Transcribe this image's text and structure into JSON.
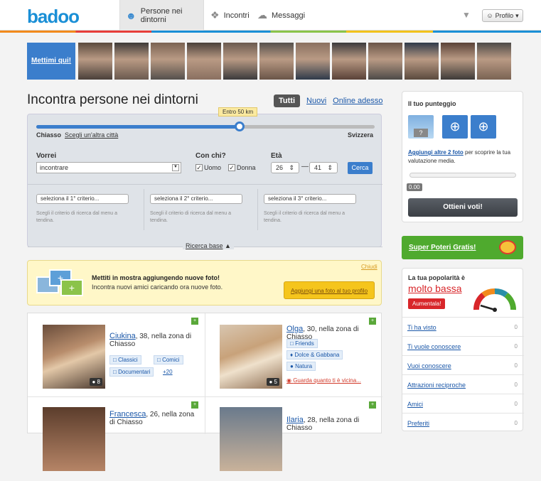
{
  "header": {
    "logo": "badoo",
    "nav": [
      {
        "label": "Persone nei dintorni",
        "icon": "people-icon"
      },
      {
        "label": "Incontri",
        "icon": "puzzle-icon"
      },
      {
        "label": "Messaggi",
        "icon": "chat-icon"
      }
    ],
    "profile_label": "Profilo"
  },
  "strip": {
    "cta": "Mettimi qui!"
  },
  "main": {
    "title": "Incontra persone nei dintorni",
    "tabs": [
      "Tutti",
      "Nuovi",
      "Online adesso"
    ]
  },
  "search": {
    "distance_tooltip": "Entro 50 km",
    "distance_fraction": 0.6,
    "left_label": "Chiasso",
    "city_link": "Scegli un'altra città",
    "right_label": "Svizzera",
    "vorrei_label": "Vorrei",
    "vorrei_value": "incontrare",
    "conchi_label": "Con chi?",
    "uomo": "Uomo",
    "donna": "Donna",
    "eta_label": "Età",
    "age_min": "26",
    "age_max": "41",
    "cerca": "Cerca",
    "criteria": [
      "seleziona il 1° criterio...",
      "seleziona il 2° criterio...",
      "seleziona il 3° criterio..."
    ],
    "criteria_hint": "Scegli il criterio di ricerca dal menu a tendina.",
    "basic_search": "Ricerca base"
  },
  "promo": {
    "title": "Mettiti in mostra aggiungendo nuove foto!",
    "subtitle": "Incontra nuovi amici caricando ora nuove foto.",
    "close": "Chiudi",
    "button": "Aggiungi una foto al tuo profilo"
  },
  "results": [
    {
      "name": "Ciukina",
      "info": ", 38, nella zona di Chiasso",
      "photos": "8",
      "tags": [
        "Classici",
        "Comici",
        "Documentari"
      ],
      "more": "+20"
    },
    {
      "name": "Olga",
      "info": ", 30, nella zona di Chiasso",
      "photos": "5",
      "tags": [
        "Friends",
        "Dolce & Gabbana",
        "Natura"
      ],
      "link": "Guarda quanto ti è vicina..."
    },
    {
      "name": "Francesca",
      "info": ", 26, nella zona di Chiasso"
    },
    {
      "name": "Ilaria",
      "info": ", 28, nella zona di Chiasso"
    }
  ],
  "sidebar": {
    "score_title": "Il tuo punteggio",
    "score_link": "Aggiungi altre 2 foto",
    "score_text": " per scoprire la tua valutazione media.",
    "score_value": "0.00",
    "get_votes": "Ottieni voti!",
    "super_powers": "Super Poteri Gratis!",
    "popularity_label": "La tua popolarità è",
    "popularity_value": "molto bassa",
    "increase": "Aumentala!",
    "stats": [
      {
        "label": "Ti ha visto",
        "count": "0"
      },
      {
        "label": "Ti vuole conoscere",
        "count": "0"
      },
      {
        "label": "Vuoi conoscere",
        "count": "0"
      },
      {
        "label": "Attrazioni reciproche",
        "count": "0"
      },
      {
        "label": "Amici",
        "count": "0"
      },
      {
        "label": "Preferiti",
        "count": "0"
      }
    ]
  },
  "colors": {
    "brand_blue": "#1a8fd6",
    "brand_orange": "#f28a1c",
    "alert_red": "#d8262a",
    "promo_green": "#4faa2e"
  }
}
